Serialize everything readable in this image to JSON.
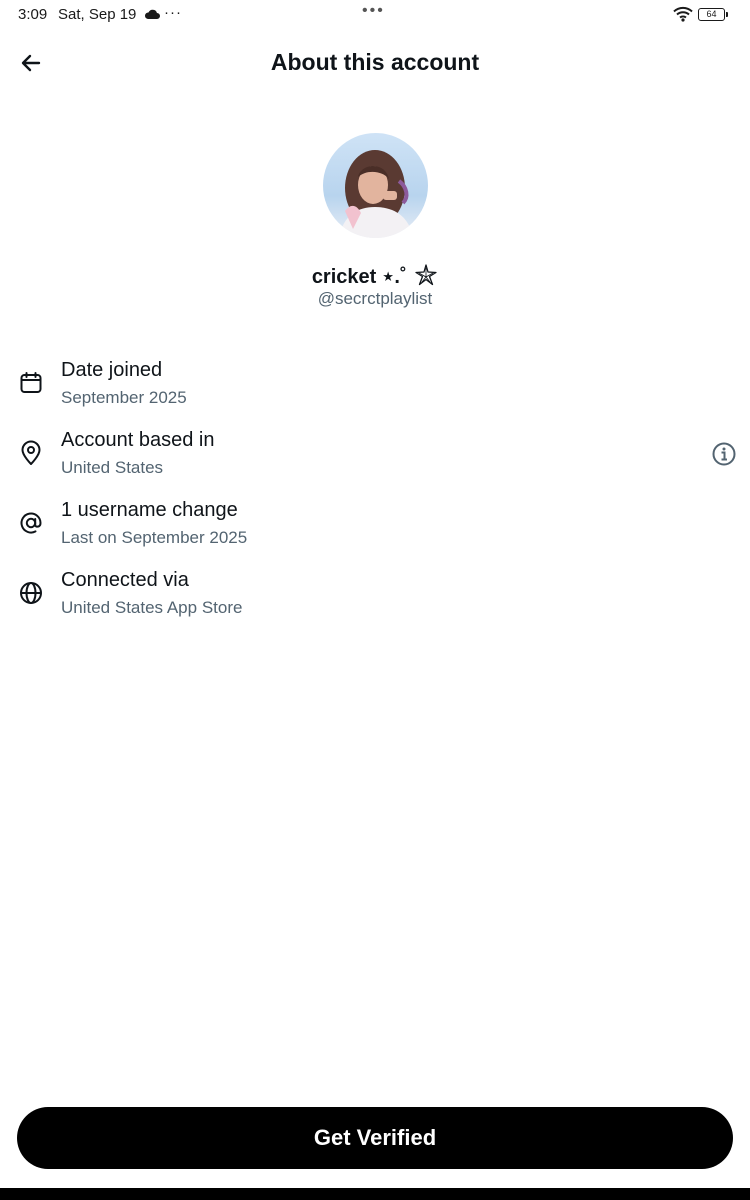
{
  "status_bar": {
    "time": "3:09",
    "date": "Sat, Sep 19",
    "more": "···",
    "center_dots": "•••",
    "battery": "64"
  },
  "header": {
    "title": "About this account",
    "back_icon": "arrow-left-icon"
  },
  "profile": {
    "display_name": "cricket ⋆.˚",
    "name_icon": "starfish-icon",
    "handle": "@secrctplaylist"
  },
  "details": [
    {
      "icon": "calendar-icon",
      "title": "Date joined",
      "value": "September 2025"
    },
    {
      "icon": "location-pin-icon",
      "title": "Account based in",
      "value": "United States",
      "action_icon": "info-icon"
    },
    {
      "icon": "at-sign-icon",
      "title": "1 username change",
      "value": "Last on September 2025"
    },
    {
      "icon": "globe-icon",
      "title": "Connected via",
      "value": "United States App Store"
    }
  ],
  "footer": {
    "cta_label": "Get Verified"
  },
  "colors": {
    "primary_text": "#0f1419",
    "secondary_text": "#536471",
    "button_bg": "#000000",
    "button_text": "#ffffff"
  }
}
